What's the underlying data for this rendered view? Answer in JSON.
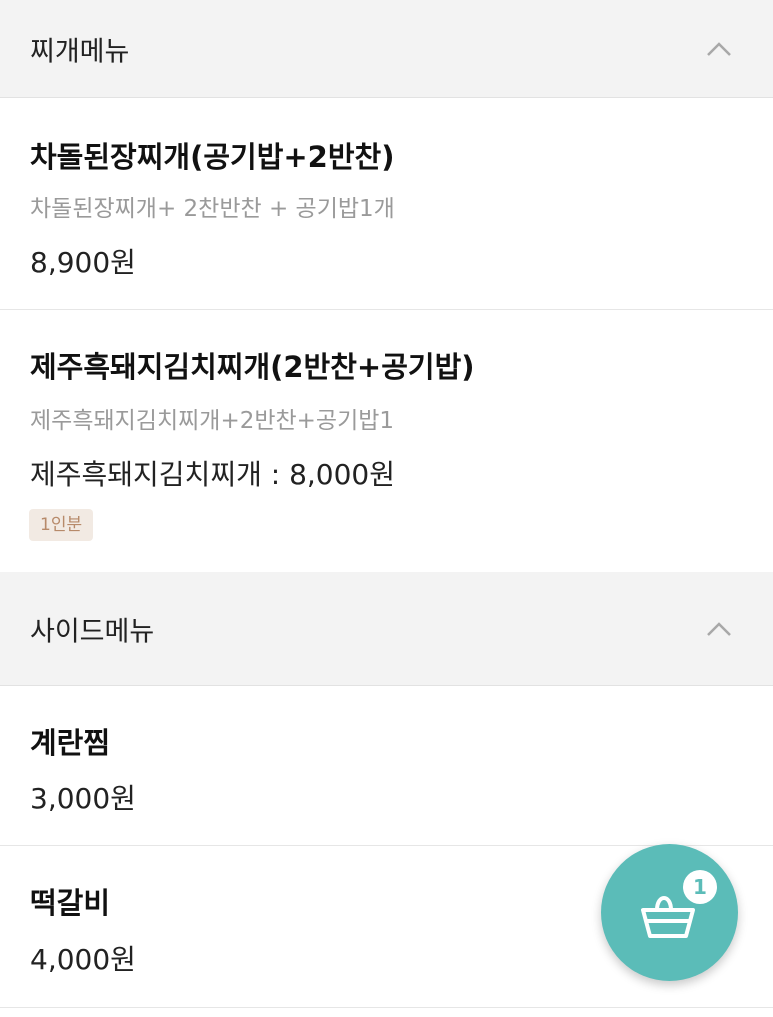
{
  "sections": [
    {
      "title": "찌개메뉴",
      "items": [
        {
          "name": "차돌된장찌개(공기밥+2반찬)",
          "description": "차돌된장찌개+ 2찬반찬 + 공기밥1개",
          "price": "8,900원"
        },
        {
          "name": "제주흑돼지김치찌개(2반찬+공기밥)",
          "description": "제주흑돼지김치찌개+2반찬+공기밥1",
          "price": "제주흑돼지김치찌개 : 8,000원",
          "badge": "1인분"
        }
      ]
    },
    {
      "title": "사이드메뉴",
      "items": [
        {
          "name": "계란찜",
          "price": "3,000원"
        },
        {
          "name": "떡갈비",
          "price": "4,000원"
        }
      ]
    }
  ],
  "cart": {
    "count": "1",
    "icon": "shopping-basket-icon"
  },
  "icons": {
    "collapse": "chevron-up-icon"
  },
  "colors": {
    "accent": "#5bbcb8",
    "badge_bg": "#f2eae3",
    "badge_text": "#b78a6a",
    "header_bg": "#f3f3f3"
  }
}
